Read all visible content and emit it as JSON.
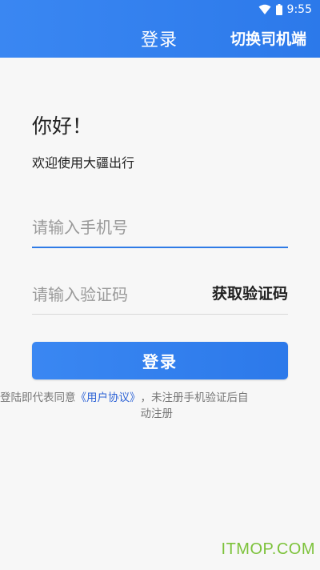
{
  "status_bar": {
    "time": "9:55",
    "wifi_icon": "wifi-icon",
    "battery_icon": "battery-icon"
  },
  "app_bar": {
    "title": "登录",
    "switch_driver": "切换司机端",
    "color": "#3a87f2"
  },
  "greeting": "你好！",
  "welcome": "欢迎使用大疆出行",
  "phone_input": {
    "placeholder": "请输入手机号",
    "value": ""
  },
  "code_input": {
    "placeholder": "请输入验证码",
    "value": "",
    "get_code_label": "获取验证码"
  },
  "login_button": "登录",
  "agreement": {
    "prefix": "登陆即代表同意",
    "link": "《用户协议》",
    "suffix_line1": "，未注册手机验证后自",
    "suffix_line2": "动注册"
  },
  "watermark": "ITMOP.COM"
}
